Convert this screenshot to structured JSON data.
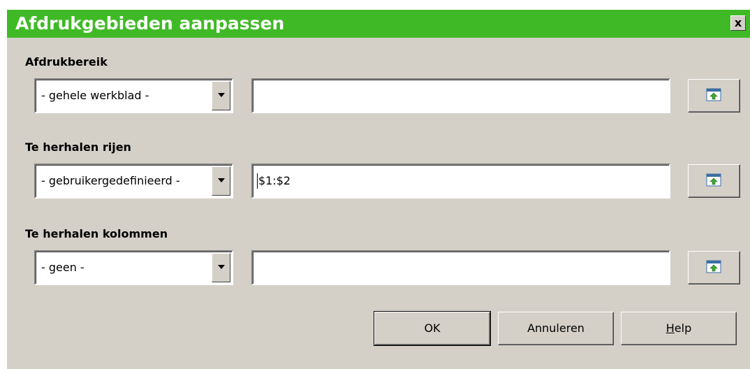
{
  "dialog": {
    "title": "Afdrukgebieden aanpassen",
    "close_label": "x"
  },
  "sections": [
    {
      "label": "Afdrukbereik",
      "combo_value": "- gehele werkblad -",
      "field_value": ""
    },
    {
      "label": "Te herhalen rijen",
      "combo_value": "- gebruikergedefinieerd -",
      "field_value": "$1:$2"
    },
    {
      "label": "Te herhalen kolommen",
      "combo_value": "- geen -",
      "field_value": ""
    }
  ],
  "buttons": {
    "ok": "OK",
    "cancel": "Annuleren",
    "help_mnemonic": "H",
    "help_rest": "elp"
  },
  "colors": {
    "titlebar": "#3fba26",
    "dialog_bg": "#d4d0c8"
  },
  "icons": {
    "close": "close-icon",
    "dropdown": "chevron-down-icon",
    "shrink": "shrink-dialog-icon"
  }
}
